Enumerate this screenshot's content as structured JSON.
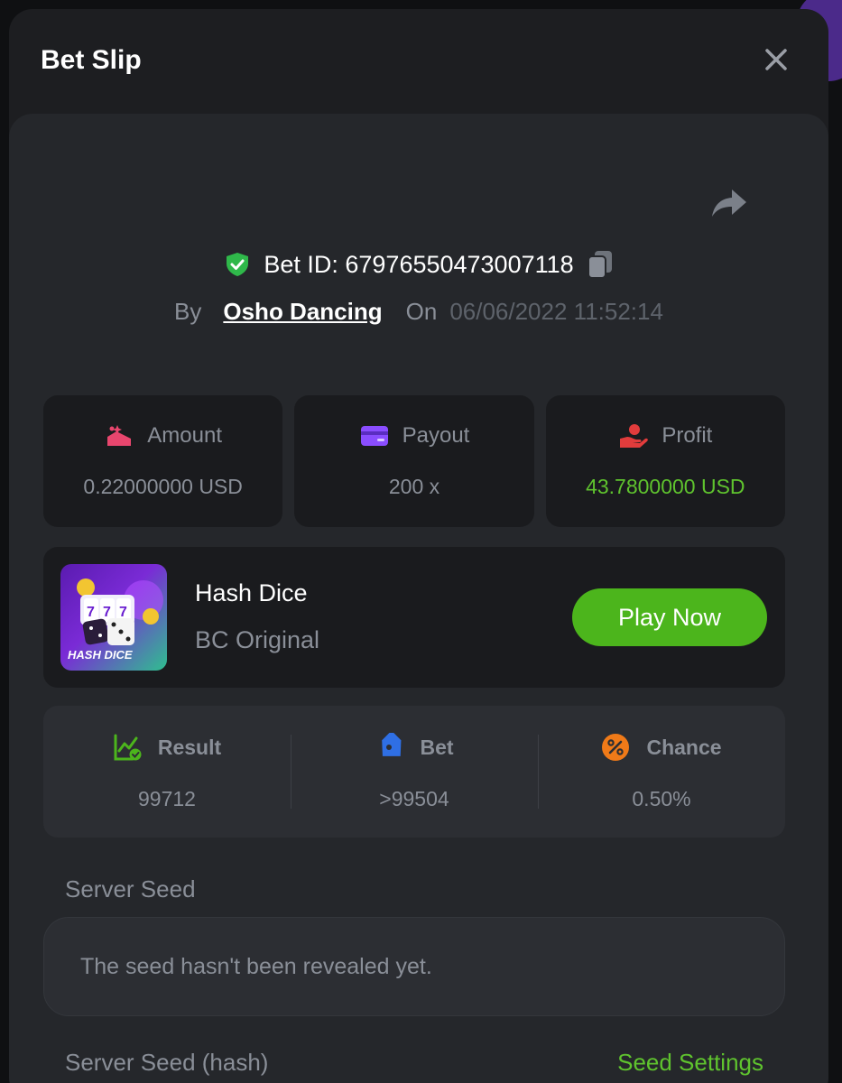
{
  "modal": {
    "title": "Bet Slip"
  },
  "bet": {
    "id_label": "Bet ID: 679765504730071​18",
    "by_label": "By",
    "user": "Osho Dancing",
    "on_label": "On",
    "date": "06/06/2022 11:52:14"
  },
  "stats": [
    {
      "label": "Amount",
      "value": "0.22000000 USD",
      "icon": "amount-icon",
      "icon_color": "#e8466e"
    },
    {
      "label": "Payout",
      "value": "200 x",
      "icon": "wallet-icon",
      "icon_color": "#8a4dff"
    },
    {
      "label": "Profit",
      "value": "43.7800000 USD",
      "icon": "profit-hand-icon",
      "icon_color": "#e23c3c",
      "value_color": "#5fc32e"
    }
  ],
  "game": {
    "name": "Hash Dice",
    "provider": "BC Original",
    "thumb_label": "HASH DICE",
    "play_label": "Play Now"
  },
  "results": [
    {
      "label": "Result",
      "value": "99712",
      "icon": "chart-check-icon",
      "icon_color": "#4cb51c"
    },
    {
      "label": "Bet",
      "value": ">99504",
      "icon": "tag-icon",
      "icon_color": "#2f6fe4"
    },
    {
      "label": "Chance",
      "value": "0.50%",
      "icon": "percent-icon",
      "icon_color": "#f07a18"
    }
  ],
  "seed": {
    "server_label": "Server Seed",
    "server_value": "The seed hasn't been revealed yet.",
    "hash_label": "Server Seed (hash)",
    "settings_label": "Seed Settings"
  },
  "colors": {
    "accent_green": "#4cb51c",
    "text_green": "#5fc32e",
    "modal_bg": "#1d1e21",
    "card_bg": "#1a1b1e"
  }
}
